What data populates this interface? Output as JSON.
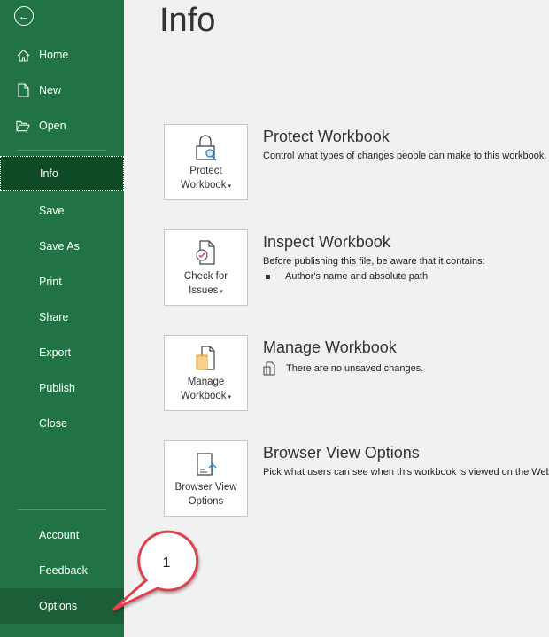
{
  "sidebar": {
    "items": [
      {
        "label": "Home",
        "icon": "home-icon"
      },
      {
        "label": "New",
        "icon": "new-document-icon"
      },
      {
        "label": "Open",
        "icon": "folder-open-icon"
      },
      {
        "label": "Info"
      },
      {
        "label": "Save"
      },
      {
        "label": "Save As"
      },
      {
        "label": "Print"
      },
      {
        "label": "Share"
      },
      {
        "label": "Export"
      },
      {
        "label": "Publish"
      },
      {
        "label": "Close"
      }
    ],
    "bottom": [
      {
        "label": "Account"
      },
      {
        "label": "Feedback"
      },
      {
        "label": "Options"
      }
    ],
    "selected": "Info"
  },
  "main": {
    "title": "Info",
    "sections": [
      {
        "button": [
          "Protect",
          "Workbook"
        ],
        "title": "Protect Workbook",
        "desc": "Control what types of changes people can make to this workbook."
      },
      {
        "button": [
          "Check for",
          "Issues"
        ],
        "title": "Inspect Workbook",
        "desc": "Before publishing this file, be aware that it contains:",
        "bullet": "Author's name and absolute path"
      },
      {
        "button": [
          "Manage",
          "Workbook"
        ],
        "title": "Manage Workbook",
        "desc": "There are no unsaved changes."
      },
      {
        "button": [
          "Browser View",
          "Options"
        ],
        "title": "Browser View Options",
        "desc": "Pick what users can see when this workbook is viewed on the Web."
      }
    ]
  },
  "callout": {
    "number": "1"
  },
  "colors": {
    "sidebar": "#217346",
    "selected": "#0e4a25",
    "callout_border": "#e0404f"
  }
}
